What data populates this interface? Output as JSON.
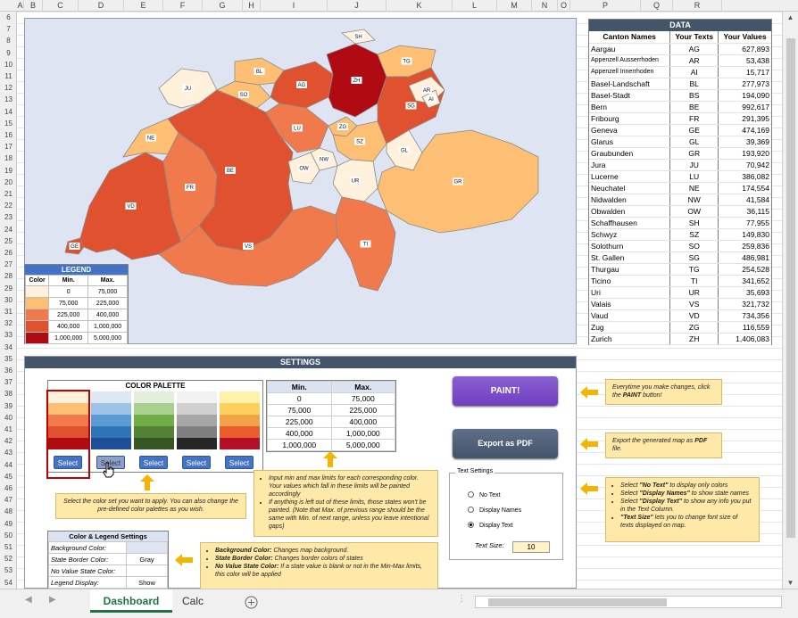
{
  "sheet": {
    "columns": [
      "A",
      "B",
      "C",
      "D",
      "E",
      "F",
      "G",
      "H",
      "I",
      "J",
      "K",
      "L",
      "M",
      "N",
      "O",
      "P",
      "Q",
      "R"
    ],
    "row_start": 6,
    "row_end": 54
  },
  "map": {
    "background_color": "#dfe4f2",
    "cantons": [
      {
        "code": "SH",
        "color": "#fff1dc"
      },
      {
        "code": "TG",
        "color": "#fdbf74"
      },
      {
        "code": "JU",
        "color": "#fff1dc"
      },
      {
        "code": "BL",
        "color": "#fdbf74"
      },
      {
        "code": "AG",
        "color": "#e0522f"
      },
      {
        "code": "ZH",
        "color": "#b00b12"
      },
      {
        "code": "SO",
        "color": "#fdbf74"
      },
      {
        "code": "AR",
        "color": "#fff1dc"
      },
      {
        "code": "AI",
        "color": "#fff1dc"
      },
      {
        "code": "SG",
        "color": "#e0522f"
      },
      {
        "code": "LU",
        "color": "#f07a4c"
      },
      {
        "code": "ZG",
        "color": "#fdbf74"
      },
      {
        "code": "SZ",
        "color": "#fdbf74"
      },
      {
        "code": "NE",
        "color": "#fdbf74"
      },
      {
        "code": "NW",
        "color": "#fff1dc"
      },
      {
        "code": "GL",
        "color": "#fff1dc"
      },
      {
        "code": "OW",
        "color": "#fff1dc"
      },
      {
        "code": "UR",
        "color": "#fff1dc"
      },
      {
        "code": "BE",
        "color": "#e0522f"
      },
      {
        "code": "FR",
        "color": "#f07a4c"
      },
      {
        "code": "GR",
        "color": "#fdbf74"
      },
      {
        "code": "VD",
        "color": "#e0522f"
      },
      {
        "code": "TI",
        "color": "#f07a4c"
      },
      {
        "code": "VS",
        "color": "#f07a4c"
      },
      {
        "code": "GE",
        "color": "#e0522f"
      }
    ]
  },
  "legend": {
    "title": "LEGEND",
    "col_color": "Color",
    "col_min": "Min.",
    "col_max": "Max.",
    "rows": [
      {
        "color": "#fff1dc",
        "min": "0",
        "max": "75,000"
      },
      {
        "color": "#fdbf74",
        "min": "75,000",
        "max": "225,000"
      },
      {
        "color": "#f07a4c",
        "min": "225,000",
        "max": "400,000"
      },
      {
        "color": "#e0522f",
        "min": "400,000",
        "max": "1,000,000"
      },
      {
        "color": "#b00b12",
        "min": "1,000,000",
        "max": "5,000,000"
      }
    ]
  },
  "data_table": {
    "title": "DATA",
    "headers": [
      "Canton Names",
      "Your Texts",
      "Your Values"
    ],
    "rows": [
      [
        "Aargau",
        "AG",
        "627,893"
      ],
      [
        "Appenzell Ausserrhoden",
        "AR",
        "53,438"
      ],
      [
        "Appenzell Innerrhoden",
        "AI",
        "15,717"
      ],
      [
        "Basel-Landschaft",
        "BL",
        "277,973"
      ],
      [
        "Basel-Stadt",
        "BS",
        "194,090"
      ],
      [
        "Bern",
        "BE",
        "992,617"
      ],
      [
        "Fribourg",
        "FR",
        "291,395"
      ],
      [
        "Geneva",
        "GE",
        "474,169"
      ],
      [
        "Glarus",
        "GL",
        "39,369"
      ],
      [
        "Graubunden",
        "GR",
        "193,920"
      ],
      [
        "Jura",
        "JU",
        "70,942"
      ],
      [
        "Lucerne",
        "LU",
        "386,082"
      ],
      [
        "Neuchatel",
        "NE",
        "174,554"
      ],
      [
        "Nidwalden",
        "NW",
        "41,584"
      ],
      [
        "Obwalden",
        "OW",
        "36,115"
      ],
      [
        "Schaffhausen",
        "SH",
        "77,955"
      ],
      [
        "Schwyz",
        "SZ",
        "149,830"
      ],
      [
        "Solothurn",
        "SO",
        "259,836"
      ],
      [
        "St. Gallen",
        "SG",
        "486,981"
      ],
      [
        "Thurgau",
        "TG",
        "254,528"
      ],
      [
        "Ticino",
        "TI",
        "341,652"
      ],
      [
        "Uri",
        "UR",
        "35,693"
      ],
      [
        "Valais",
        "VS",
        "321,732"
      ],
      [
        "Vaud",
        "VD",
        "734,356"
      ],
      [
        "Zug",
        "ZG",
        "116,559"
      ],
      [
        "Zurich",
        "ZH",
        "1,406,083"
      ]
    ]
  },
  "settings": {
    "title": "SETTINGS",
    "palette_title": "COLOR PALETTE",
    "palettes": [
      {
        "colors": [
          "#fff1dc",
          "#fdbf74",
          "#f07a4c",
          "#e0522f",
          "#b00b12"
        ],
        "select_label": "Select",
        "hover": false
      },
      {
        "colors": [
          "#dde8f4",
          "#9dc3e6",
          "#5b9bd5",
          "#2e75b6",
          "#1f4e99"
        ],
        "select_label": "Select",
        "hover": true
      },
      {
        "colors": [
          "#e2efda",
          "#a9d08e",
          "#70ad47",
          "#548235",
          "#375623"
        ],
        "select_label": "Select",
        "hover": false
      },
      {
        "colors": [
          "#f2f2f2",
          "#d0d0d0",
          "#a6a6a6",
          "#7f7f7f",
          "#262626"
        ],
        "select_label": "Select",
        "hover": false
      },
      {
        "colors": [
          "#fff2a8",
          "#fbd15b",
          "#f4a247",
          "#e95c2b",
          "#b5102a"
        ],
        "select_label": "Select",
        "hover": false
      }
    ],
    "minmax_headers": [
      "Min.",
      "Max."
    ],
    "minmax_rows": [
      [
        "0",
        "75,000"
      ],
      [
        "75,000",
        "225,000"
      ],
      [
        "225,000",
        "400,000"
      ],
      [
        "400,000",
        "1,000,000"
      ],
      [
        "1,000,000",
        "5,000,000"
      ]
    ],
    "paint_button": "PAINT!",
    "export_button": "Export as PDF",
    "text_settings": {
      "caption": "Text Settings",
      "options": [
        "No Text",
        "Display Names",
        "Display Text"
      ],
      "selected": "Display Text",
      "size_label": "Text Size:",
      "size_value": "10"
    },
    "color_legend": {
      "title": "Color & Legend Settings",
      "rows": [
        {
          "label": "Background Color:",
          "value": ""
        },
        {
          "label": "State Border Color:",
          "value": "Gray"
        },
        {
          "label": "No Value State Color:",
          "value": ""
        },
        {
          "label": "Legend Display:",
          "value": "Show"
        }
      ]
    }
  },
  "notes": {
    "palette": "Select the color set you want to apply. You can also change the pre-defined color palettes as you wish.",
    "minmax_1": "Input min and max limits for each corresponding color. Your values which fall in these limits will be painted accordingly",
    "minmax_2": "If anything is left out of these limits, those states won't be painted. (Note that Max. of previous range should be the same with Min. of next range, unless you leave intentional gaps)",
    "paint_pre": "Everytime you make changes, click the ",
    "paint_bold": "PAINT",
    "paint_post": " button!",
    "pdf_pre": "Export the generated map as ",
    "pdf_bold": "PDF",
    "pdf_post": " file.",
    "text_1_pre": "Select ",
    "text_1_bold": "\"No Text\"",
    "text_1_post": " to display only colors",
    "text_2_pre": "Select ",
    "text_2_bold": "\"Display Names\"",
    "text_2_post": " to show state names",
    "text_3_pre": "Select ",
    "text_3_bold": "\"Display Text\"",
    "text_3_post": " to show any info you put in the Text Column.",
    "text_4_bold": "\"Text Size\"",
    "text_4_post": " lets you to change font size of texts displayed on map.",
    "cls_1_bold": "Background Color:",
    "cls_1_post": " Changes map background.",
    "cls_2_bold": "State Border Color:",
    "cls_2_post": " Changes border colors of states",
    "cls_3_bold": "No Value State Color:",
    "cls_3_post": " If a state value is blank or not in the Min-Max limits, this color will be applied"
  },
  "tabs": [
    {
      "label": "Dashboard",
      "active": true
    },
    {
      "label": "Calc",
      "active": false
    }
  ],
  "add_sheet_icon": "plus-circle-icon"
}
